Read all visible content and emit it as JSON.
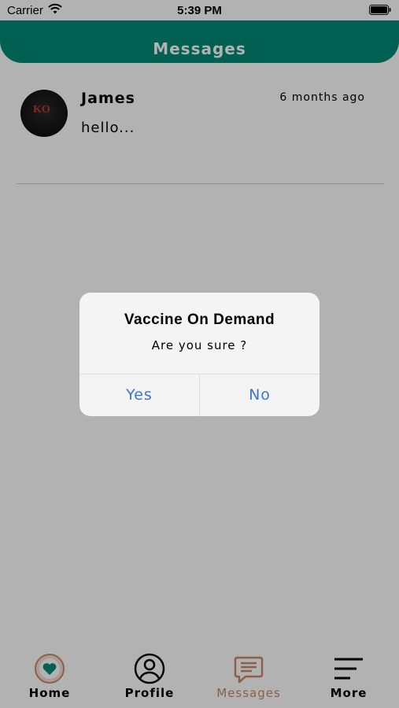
{
  "status_bar": {
    "carrier": "Carrier",
    "time": "5:39 PM",
    "wifi_icon": "wifi-icon",
    "battery_icon": "battery-icon"
  },
  "header": {
    "title": "Messages",
    "color": "#008a74"
  },
  "messages": [
    {
      "name": "James",
      "time": "6 months ago",
      "preview": "hello..."
    }
  ],
  "dialog": {
    "title": "Vaccine On Demand",
    "message": "Are you sure ?",
    "yes_label": "Yes",
    "no_label": "No",
    "button_color": "#3d74d3"
  },
  "tabbar": {
    "active_color": "#c78a66",
    "tabs": [
      {
        "label": "Home",
        "icon": "heart-logo-icon"
      },
      {
        "label": "Profile",
        "icon": "user-circle-icon"
      },
      {
        "label": "Messages",
        "icon": "chat-bubble-icon",
        "active": true
      },
      {
        "label": "More",
        "icon": "menu-lines-icon"
      }
    ]
  }
}
